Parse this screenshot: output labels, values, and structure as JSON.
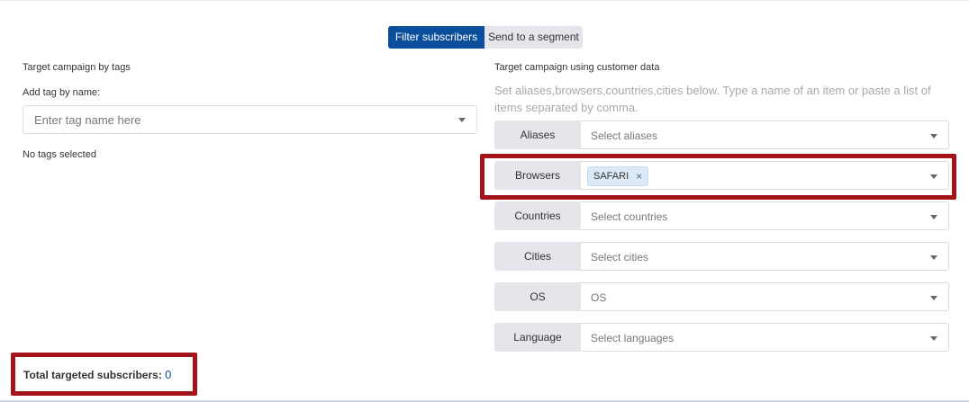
{
  "toggle": {
    "active_label": "Filter subscribers",
    "inactive_label": "Send to a segment"
  },
  "left": {
    "title": "Target campaign by tags",
    "add_label": "Add tag by name:",
    "tag_placeholder": "Enter tag name here",
    "no_tags": "No tags selected"
  },
  "right": {
    "title": "Target campaign using customer data",
    "hint": "Set aliases,browsers,countries,cities below. Type a name of an item or paste a list of items separated by comma.",
    "rows": [
      {
        "label": "Aliases",
        "placeholder": "Select aliases"
      },
      {
        "label": "Browsers",
        "chip": "SAFARI"
      },
      {
        "label": "Countries",
        "placeholder": "Select countries"
      },
      {
        "label": "Cities",
        "placeholder": "Select cities"
      },
      {
        "label": "OS",
        "placeholder": "OS"
      },
      {
        "label": "Language",
        "placeholder": "Select languages"
      }
    ]
  },
  "total": {
    "label": "Total targeted subscribers:",
    "count": "0"
  },
  "colors": {
    "accent": "#0b4f9c",
    "highlight": "#a3141a",
    "label_bg": "#e4e6eb",
    "chip_bg": "#dce9f6"
  }
}
